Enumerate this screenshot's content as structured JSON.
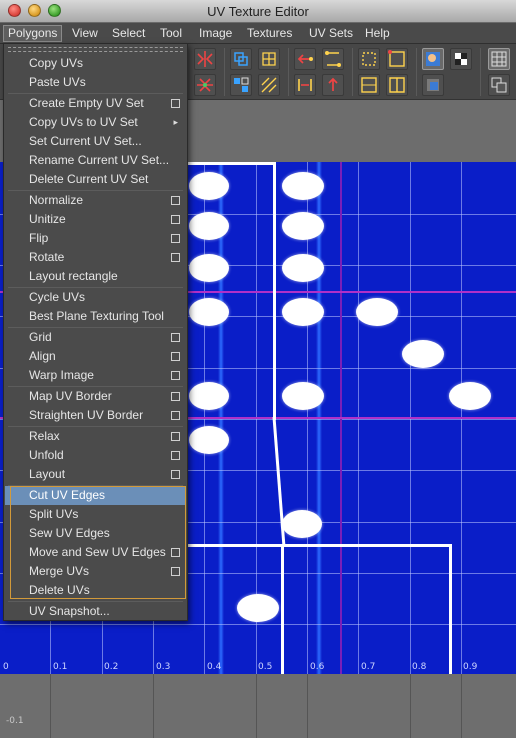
{
  "window": {
    "title": "UV Texture Editor"
  },
  "menubar": [
    {
      "label": "Polygons",
      "open": true
    },
    {
      "label": "View"
    },
    {
      "label": "Select"
    },
    {
      "label": "Tool"
    },
    {
      "label": "Image"
    },
    {
      "label": "Textures"
    },
    {
      "label": "UV Sets"
    },
    {
      "label": "Help"
    }
  ],
  "dropdown": {
    "items": [
      {
        "label": "Copy UVs",
        "option": false
      },
      {
        "label": "Paste UVs",
        "option": false
      },
      {
        "label": "Create Empty UV Set",
        "option": true
      },
      {
        "label": "Copy UVs to UV Set",
        "submenu": true
      },
      {
        "label": "Set Current UV Set...",
        "option": false
      },
      {
        "label": "Rename Current UV Set...",
        "option": false
      },
      {
        "label": "Delete Current UV Set",
        "option": false
      },
      {
        "label": "Normalize",
        "option": true
      },
      {
        "label": "Unitize",
        "option": true
      },
      {
        "label": "Flip",
        "option": true
      },
      {
        "label": "Rotate",
        "option": true
      },
      {
        "label": "Layout rectangle",
        "option": false
      },
      {
        "label": "Cycle UVs",
        "option": false
      },
      {
        "label": "Best Plane Texturing Tool",
        "option": false
      },
      {
        "label": "Grid",
        "option": true
      },
      {
        "label": "Align",
        "option": true
      },
      {
        "label": "Warp Image",
        "option": true
      },
      {
        "label": "Map UV Border",
        "option": true
      },
      {
        "label": "Straighten UV Border",
        "option": true
      },
      {
        "label": "Relax",
        "option": true
      },
      {
        "label": "Unfold",
        "option": true
      },
      {
        "label": "Layout",
        "option": true
      },
      {
        "label": "Cut UV Edges",
        "option": false,
        "highlighted": true
      },
      {
        "label": "Split UVs",
        "option": false
      },
      {
        "label": "Sew UV Edges",
        "option": false
      },
      {
        "label": "Move and Sew UV Edges",
        "option": true
      },
      {
        "label": "Merge UVs",
        "option": true
      },
      {
        "label": "Delete UVs",
        "option": false
      },
      {
        "label": "UV Snapshot...",
        "option": false
      }
    ]
  },
  "viewport": {
    "tick_labels": [
      "0",
      "0.1",
      "0.2",
      "0.3",
      "0.4",
      "0.5",
      "0.6",
      "0.7",
      "0.8",
      "0.9"
    ],
    "texture_color": "#0a1ec8",
    "bottom_label": "-0.1"
  },
  "colors": {
    "highlight": "#6b8fb8",
    "group_frame": "#d29a3a"
  }
}
